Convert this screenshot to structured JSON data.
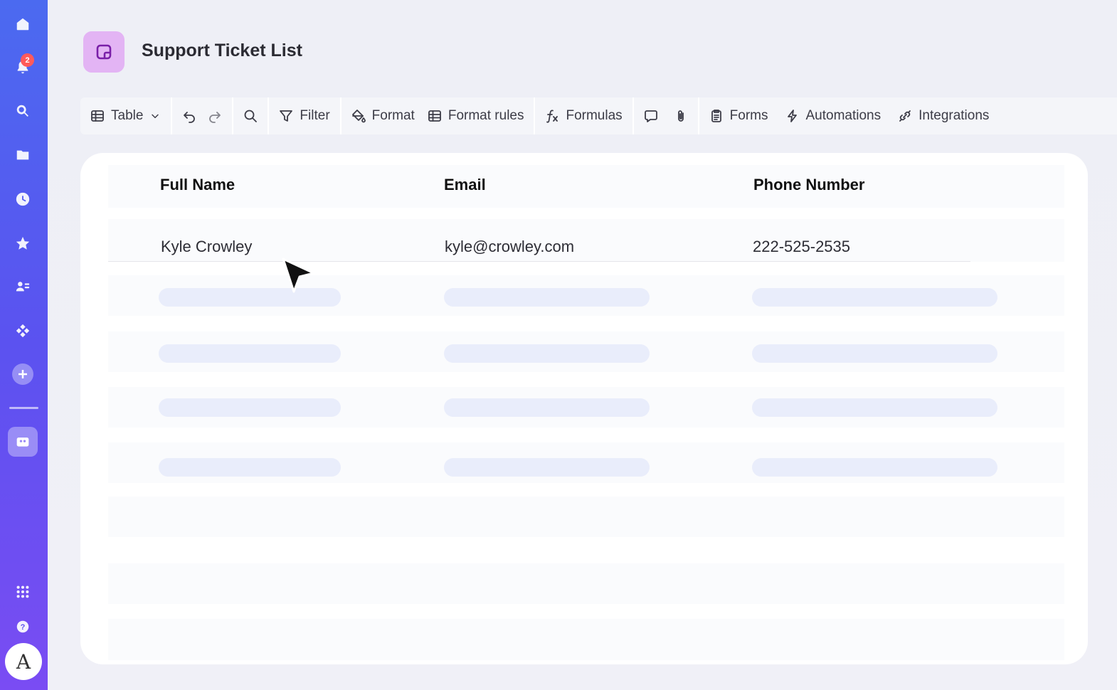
{
  "sidebar": {
    "notification_count": "2",
    "avatar_letter": "A"
  },
  "header": {
    "title": "Support Ticket List"
  },
  "toolbar": {
    "view_label": "Table",
    "filter_label": "Filter",
    "format_label": "Format",
    "format_rules_label": "Format rules",
    "formulas_label": "Formulas",
    "forms_label": "Forms",
    "automations_label": "Automations",
    "integrations_label": "Integrations"
  },
  "table": {
    "columns": [
      "Full Name",
      "Email",
      "Phone Number"
    ],
    "rows": [
      {
        "full_name": "Kyle Crowley",
        "email": "kyle@crowley.com",
        "phone": "222-525-2535"
      }
    ]
  },
  "colors": {
    "sidebar_top": "#4b6af0",
    "sidebar_bottom": "#7a4cf3",
    "app_icon_bg": "#e3b4f4",
    "badge": "#ff5a5a",
    "skeleton": "#e9edfb"
  }
}
